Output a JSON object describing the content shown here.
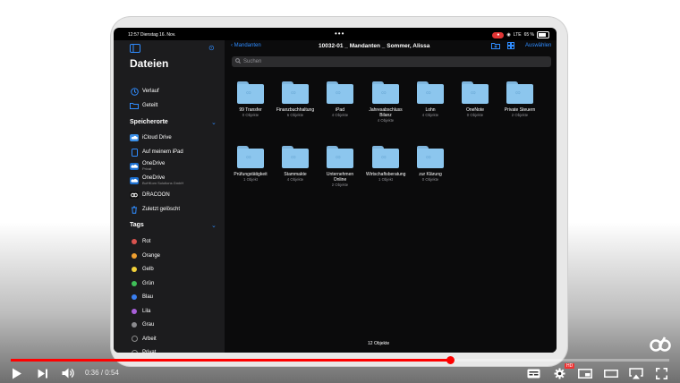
{
  "status_bar": {
    "time": "12:57",
    "date": "Dienstag 16. Nov.",
    "signal": "LTE",
    "battery": "65 %"
  },
  "sidebar": {
    "title": "Dateien",
    "top_items": [
      {
        "label": "Verlauf",
        "icon": "clock-icon"
      },
      {
        "label": "Geteilt",
        "icon": "shared-folder-icon"
      }
    ],
    "locations_header": "Speicherorte",
    "locations": [
      {
        "label": "iCloud Drive",
        "sub": "",
        "icon": "icloud-icon"
      },
      {
        "label": "Auf meinem iPad",
        "sub": "",
        "icon": "ipad-icon"
      },
      {
        "label": "OneDrive",
        "sub": "Privat",
        "icon": "onedrive-icon"
      },
      {
        "label": "OneDrive",
        "sub": "BuHKom Solutions GmbH",
        "icon": "onedrive-icon"
      },
      {
        "label": "DRACOON",
        "sub": "",
        "icon": "dracoon-icon"
      },
      {
        "label": "Zuletzt gelöscht",
        "sub": "",
        "icon": "trash-icon"
      }
    ],
    "tags_header": "Tags",
    "tags": [
      {
        "label": "Rot",
        "color": "#d9534f"
      },
      {
        "label": "Orange",
        "color": "#f0a030"
      },
      {
        "label": "Gelb",
        "color": "#f2d13a"
      },
      {
        "label": "Grün",
        "color": "#3fbf58"
      },
      {
        "label": "Blau",
        "color": "#3a7ff0"
      },
      {
        "label": "Lila",
        "color": "#a85fd9"
      },
      {
        "label": "Grau",
        "color": "#8a8a8e"
      },
      {
        "label": "Arbeit",
        "color": ""
      },
      {
        "label": "Privat",
        "color": ""
      },
      {
        "label": "Wichtig",
        "color": ""
      }
    ]
  },
  "main": {
    "back_label": "Mandanten",
    "title": "10032-01 _ Mandanten _ Sommer, Alissa",
    "select_label": "Auswählen",
    "search_placeholder": "Suchen",
    "folders": [
      {
        "name": "99 Transfer",
        "count": "0 Objekte"
      },
      {
        "name": "Finanzbuchhaltung",
        "count": "6 Objekte"
      },
      {
        "name": "iPad",
        "count": "4 Objekte"
      },
      {
        "name": "Jahresabschluss Bilanz",
        "count": "4 Objekte"
      },
      {
        "name": "Lohn",
        "count": "4 Objekte"
      },
      {
        "name": "OneNote",
        "count": "0 Objekte"
      },
      {
        "name": "Private Steuern",
        "count": "2 Objekte"
      },
      {
        "name": "Prüfungstätigkeit",
        "count": "1 Objekt"
      },
      {
        "name": "Stammakte",
        "count": "4 Objekte"
      },
      {
        "name": "Unternehmen Online",
        "count": "2 Objekte"
      },
      {
        "name": "Wirtschaftsberatung",
        "count": "1 Objekt"
      },
      {
        "name": "zur Klärung",
        "count": "0 Objekte"
      }
    ],
    "footer_count": "12 Objekte"
  },
  "player": {
    "current_time": "0:36",
    "separator": "/",
    "duration": "0:54",
    "progress_fraction": 0.667,
    "hd_badge": "HD"
  },
  "colors": {
    "accent": "#2f8cff",
    "folder": "#8cc6ee",
    "youtube_red": "#ff0000"
  }
}
